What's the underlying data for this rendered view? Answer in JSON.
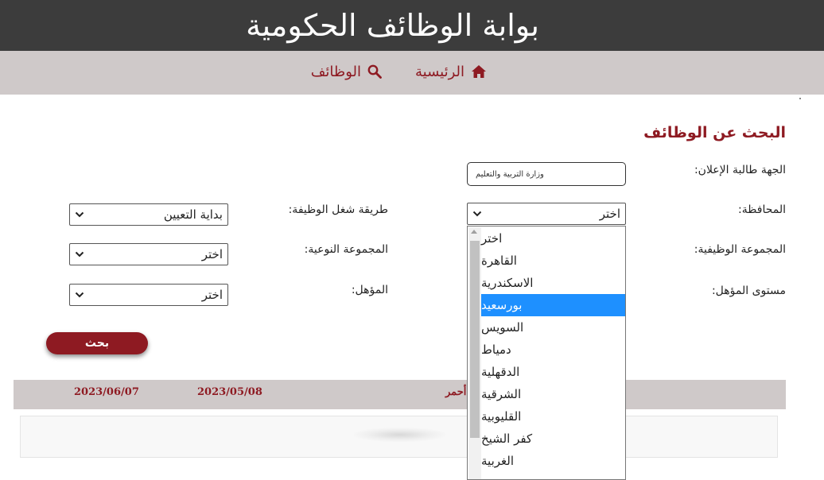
{
  "header": {
    "title": "بوابة الوظائف الحكومية"
  },
  "nav": {
    "home": "الرئيسية",
    "jobs": "الوظائف"
  },
  "search": {
    "heading": "البحث عن الوظائف",
    "issuer_label": "الجهة طالبة الإعلان:",
    "issuer_value": "وزارة التربية والتعليم",
    "governorate_label": "المحافظة:",
    "governorate_value": "اختر",
    "job_fill_method_label": "طريقة شغل الوظيفة:",
    "job_fill_method_value": "بداية التعيين",
    "job_group_label": "المجموعة الوظيفية:",
    "quality_group_label": "المجموعة النوعية:",
    "quality_group_value": "اختر",
    "qualification_level_label": "مستوى المؤهل:",
    "qualification_label": "المؤهل:",
    "qualification_value": "اختر",
    "button_label": "بحث"
  },
  "dropdown": {
    "options": [
      "اختر",
      "القاهرة",
      "الاسكندرية",
      "بورسعيد",
      "السويس",
      "دمياط",
      "الدقهلية",
      "الشرقية",
      "القليوبية",
      "كفر الشيخ",
      "الغربية"
    ],
    "selected_index": 3
  },
  "results": {
    "header_cells": [
      "أحمر",
      "2023/05/08",
      "2023/06/07"
    ]
  },
  "colors": {
    "brand": "#8e1a22",
    "topbar": "#3c3c3c",
    "navbar": "#cfc9c9",
    "highlight": "#1e90ff"
  },
  "icons": {
    "home": "home-icon",
    "search": "search-icon",
    "select": "chevron-down-icon"
  }
}
